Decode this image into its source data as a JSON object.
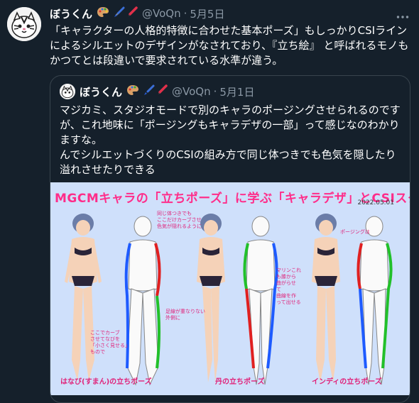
{
  "tweet": {
    "display_name": "ぼうくん",
    "handle": "@VoQn",
    "separator": "·",
    "date": "5月5日",
    "text": "「キャラクターの人格的特徴に合わせた基本ポーズ」もしっかりCSIラインによるシルエットのデザインがなされており、『立ち絵』 と呼ばれるモノもかつてとは段違いで要求されている水準が違う。"
  },
  "quoted_tweet": {
    "display_name": "ぼうくん",
    "handle": "@VoQn",
    "separator": "·",
    "date": "5月1日",
    "text": "マジカミ、スタジオモードで別のキャラのポージングさせられるのですが、これ地味に「ポージングもキャラデザの一部」って感じなのわかりますな。\nんでシルエットづくりのCSIの組み方で同じ体つきでも色気を隠したり溢れさせたりできる",
    "image": {
      "title": "MGCMキャラの「立ちポーズ」に学ぶ「キャラデザ」とCSIスタディ",
      "date": "2022.05.01",
      "captions": [
        "はなび(すまん)の立ちポーズ",
        "丹の立ちポーズ",
        "インディの立ちポーズ"
      ],
      "notes": [
        "同じ体つきでも\nここだけカーブさせ\n色気が隠れるように",
        "足線が重なりない\n外側に",
        "ここでカーブ\nさせてなびを\n「小さく見せる」\nもので",
        "マリンこれ\nも膝から\n曲がらせ\nて\n曲線を作\nって出せる",
        "ポージングは"
      ]
    }
  },
  "colors": {
    "bg": "#15202b",
    "text": "#ffffff",
    "muted": "#8b98a5",
    "border": "#38444d",
    "accent_pink": "#ff2d8a",
    "line_red": "#e02020",
    "line_blue": "#1e5bff",
    "line_green": "#22c02a"
  },
  "icons": [
    "tiger-avatar-icon",
    "palette-icon",
    "paintbrush-icon",
    "pen-icon",
    "more-options-icon"
  ]
}
